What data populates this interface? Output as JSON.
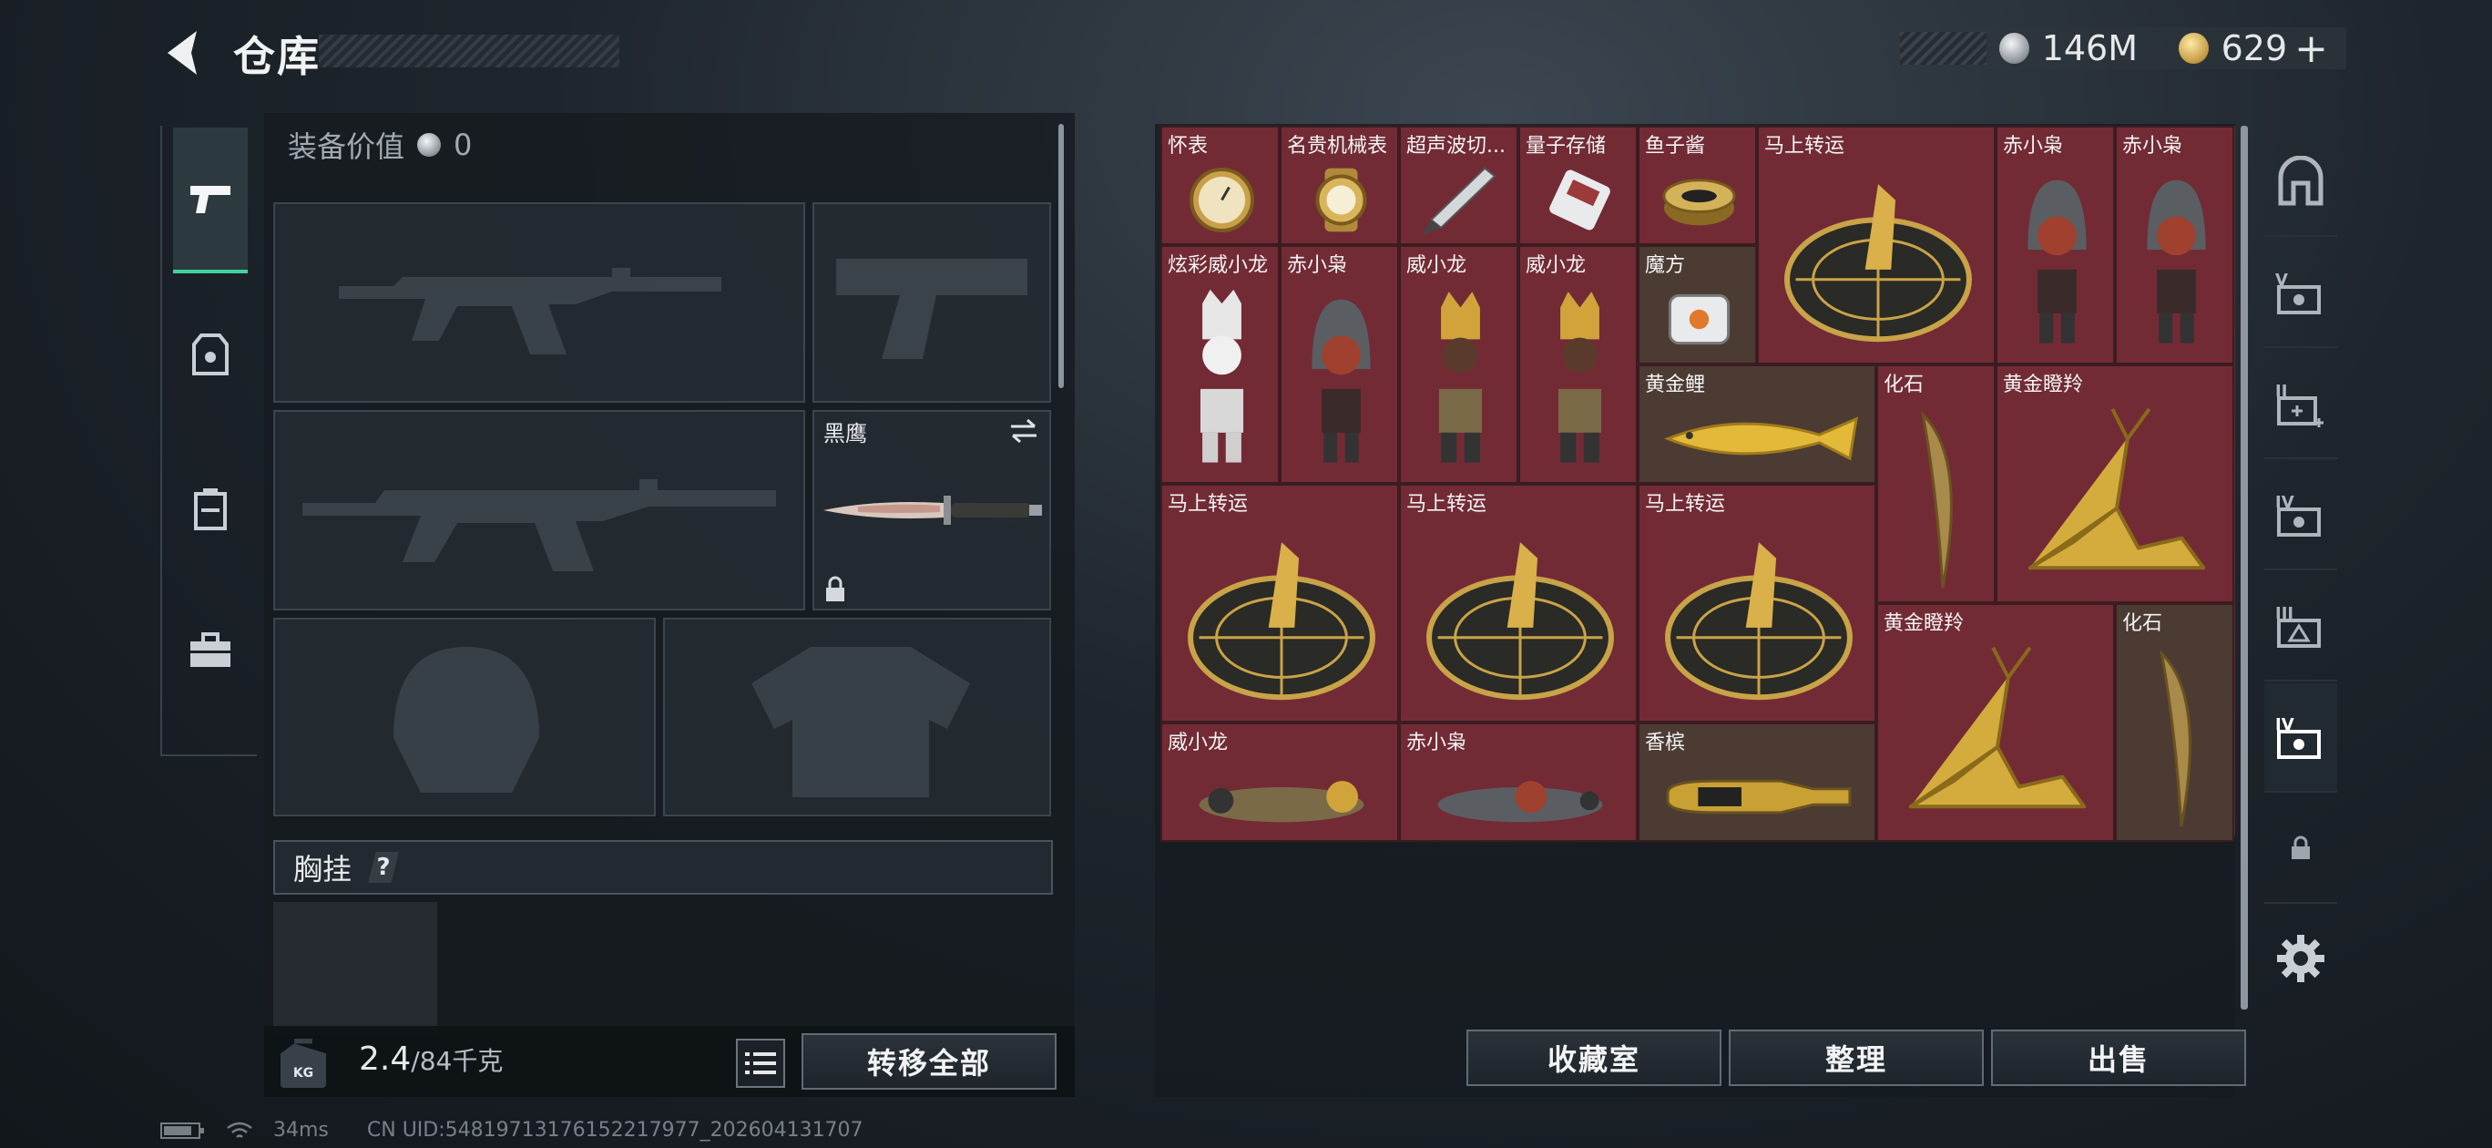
{
  "header": {
    "title": "仓库"
  },
  "currency": {
    "silver": "146M",
    "gold": "629",
    "gold_plus": "+"
  },
  "equipment": {
    "value_label": "装备价值",
    "value": "0",
    "knife_name": "黑鹰",
    "chest_label": "胸挂",
    "chest_help": "?",
    "weight": "2.4",
    "weight_max": "/84千克",
    "kg_badge": "KG",
    "transfer_all": "转移全部"
  },
  "stash": {
    "items": [
      {
        "label": "怀表",
        "icon": "pocket-watch"
      },
      {
        "label": "名贵机械表",
        "icon": "luxury-watch"
      },
      {
        "label": "超声波切...",
        "icon": "ultrasonic-cutter"
      },
      {
        "label": "量子存储",
        "icon": "quantum-storage"
      },
      {
        "label": "鱼子酱",
        "icon": "caviar"
      },
      {
        "label": "马上转运",
        "icon": "fortune-wheel"
      },
      {
        "label": "赤小枭",
        "icon": "red-owl-figure"
      },
      {
        "label": "赤小枭",
        "icon": "red-owl-figure"
      },
      {
        "label": "炫彩威小龙",
        "icon": "silver-dragon-figure"
      },
      {
        "label": "赤小枭",
        "icon": "red-owl-figure"
      },
      {
        "label": "威小龙",
        "icon": "dragon-figure"
      },
      {
        "label": "威小龙",
        "icon": "dragon-figure"
      },
      {
        "label": "魔方",
        "icon": "magic-cube"
      },
      {
        "label": "黄金鲤",
        "icon": "golden-carp"
      },
      {
        "label": "化石",
        "icon": "fossil-claw"
      },
      {
        "label": "黄金瞪羚",
        "icon": "golden-gazelle"
      },
      {
        "label": "马上转运",
        "icon": "fortune-wheel"
      },
      {
        "label": "马上转运",
        "icon": "fortune-wheel"
      },
      {
        "label": "马上转运",
        "icon": "fortune-wheel"
      },
      {
        "label": "黄金瞪羚",
        "icon": "golden-gazelle"
      },
      {
        "label": "化石",
        "icon": "fossil-claw"
      },
      {
        "label": "威小龙",
        "icon": "dragon-figure-lying"
      },
      {
        "label": "赤小枭",
        "icon": "red-owl-figure-lying"
      },
      {
        "label": "香槟",
        "icon": "champagne"
      }
    ],
    "buttons": {
      "collection": "收藏室",
      "organize": "整理",
      "sell": "出售"
    }
  },
  "status_bar": {
    "ping": "34ms",
    "uid": "CN UID:548197131761522179​77_202604131707"
  },
  "colors": {
    "accent_green": "#41d39a",
    "item_bg": "#722b35",
    "item_alt_bg": "#4b3b33"
  }
}
